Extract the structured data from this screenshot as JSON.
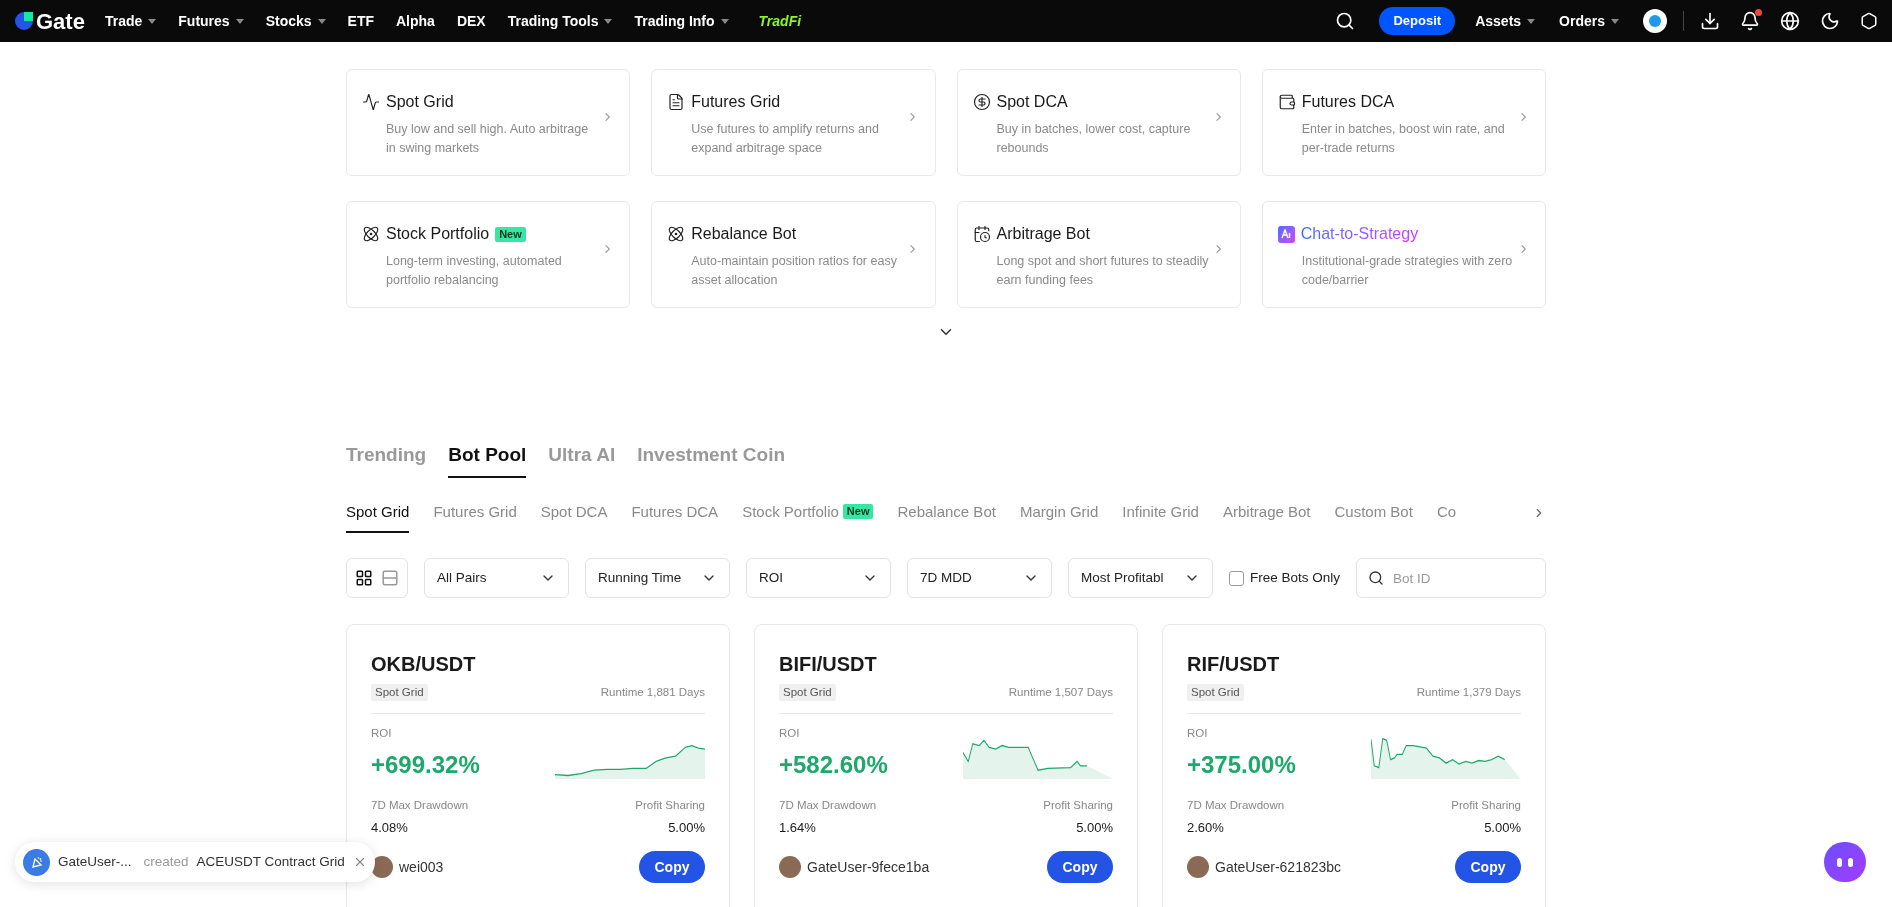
{
  "nav": {
    "logo": "Gate",
    "items": [
      {
        "label": "Trade",
        "dropdown": true
      },
      {
        "label": "Futures",
        "dropdown": true
      },
      {
        "label": "Stocks",
        "dropdown": true
      },
      {
        "label": "ETF",
        "dropdown": false
      },
      {
        "label": "Alpha",
        "dropdown": false
      },
      {
        "label": "DEX",
        "dropdown": false
      },
      {
        "label": "Trading Tools",
        "dropdown": true
      },
      {
        "label": "Trading Info",
        "dropdown": true
      }
    ],
    "tradfi": "TradFi",
    "deposit": "Deposit",
    "right_items": [
      {
        "label": "Assets",
        "dropdown": true
      },
      {
        "label": "Orders",
        "dropdown": true
      }
    ],
    "notifications_unread": true
  },
  "strategies": [
    {
      "title": "Spot Grid",
      "description": "Buy low and sell high. Auto arbitrage in swing markets",
      "kind": "plain"
    },
    {
      "title": "Futures Grid",
      "description": "Use futures to amplify returns and expand arbitrage space",
      "kind": "plain"
    },
    {
      "title": "Spot DCA",
      "description": "Buy in batches, lower cost, capture rebounds",
      "kind": "plain"
    },
    {
      "title": "Futures DCA",
      "description": "Enter in batches, boost win rate, and per-trade returns",
      "kind": "plain"
    },
    {
      "title": "Stock Portfolio",
      "badge": "New",
      "description": "Long-term investing, automated portfolio rebalancing",
      "kind": "plain"
    },
    {
      "title": "Rebalance Bot",
      "description": "Auto-maintain position ratios for easy asset allocation",
      "kind": "plain"
    },
    {
      "title": "Arbitrage Bot",
      "description": "Long spot and short futures to steadily earn funding fees",
      "kind": "plain"
    },
    {
      "title": "Chat-to-Strategy",
      "description": "Institutional-grade strategies with zero code/barrier",
      "kind": "ai"
    }
  ],
  "main_tabs": [
    {
      "label": "Trending",
      "selected": false
    },
    {
      "label": "Bot Pool",
      "selected": true
    },
    {
      "label": "Ultra AI",
      "selected": false
    },
    {
      "label": "Investment Coin",
      "selected": false
    }
  ],
  "sub_tabs": [
    {
      "label": "Spot Grid",
      "selected": true
    },
    {
      "label": "Futures Grid",
      "selected": false
    },
    {
      "label": "Spot DCA",
      "selected": false
    },
    {
      "label": "Futures DCA",
      "selected": false
    },
    {
      "label": "Stock Portfolio",
      "badge": "New",
      "selected": false
    },
    {
      "label": "Rebalance Bot",
      "selected": false
    },
    {
      "label": "Margin Grid",
      "selected": false
    },
    {
      "label": "Infinite Grid",
      "selected": false
    },
    {
      "label": "Arbitrage Bot",
      "selected": false
    },
    {
      "label": "Custom Bot",
      "selected": false
    },
    {
      "label": "Co",
      "selected": false
    }
  ],
  "view_modes": [
    {
      "kind": "grid",
      "selected": true
    },
    {
      "kind": "list",
      "selected": false
    }
  ],
  "filters": [
    {
      "value": "All Pairs"
    },
    {
      "value": "Running Time"
    },
    {
      "value": "ROI"
    },
    {
      "value": "7D MDD"
    },
    {
      "value": "Most Profitabl"
    }
  ],
  "free_bots": {
    "label": "Free Bots Only",
    "checked": false
  },
  "search": {
    "placeholder": "Bot ID"
  },
  "bots": [
    {
      "pair": "OKB/USDT",
      "tag": "Spot Grid",
      "runtime": "Runtime 1,881 Days",
      "roi_label": "ROI",
      "roi": "+699.32%",
      "drawdown_label": "7D Max Drawdown",
      "drawdown": "4.08%",
      "sharing_label": "Profit Sharing",
      "sharing": "5.00%",
      "user": "wei003",
      "button": "Copy"
    },
    {
      "pair": "BIFI/USDT",
      "tag": "Spot Grid",
      "runtime": "Runtime 1,507 Days",
      "roi_label": "ROI",
      "roi": "+582.60%",
      "drawdown_label": "7D Max Drawdown",
      "drawdown": "1.64%",
      "sharing_label": "Profit Sharing",
      "sharing": "5.00%",
      "user": "GateUser-9fece1ba",
      "button": "Copy"
    },
    {
      "pair": "RIF/USDT",
      "tag": "Spot Grid",
      "runtime": "Runtime 1,379 Days",
      "roi_label": "ROI",
      "roi": "+375.00%",
      "drawdown_label": "7D Max Drawdown",
      "drawdown": "2.60%",
      "sharing_label": "Profit Sharing",
      "sharing": "5.00%",
      "user": "GateUser-621823bc",
      "button": "Copy"
    }
  ],
  "toast": {
    "user": "GateUser-...",
    "action": "created",
    "subject": "ACEUSDT Contract Grid"
  }
}
